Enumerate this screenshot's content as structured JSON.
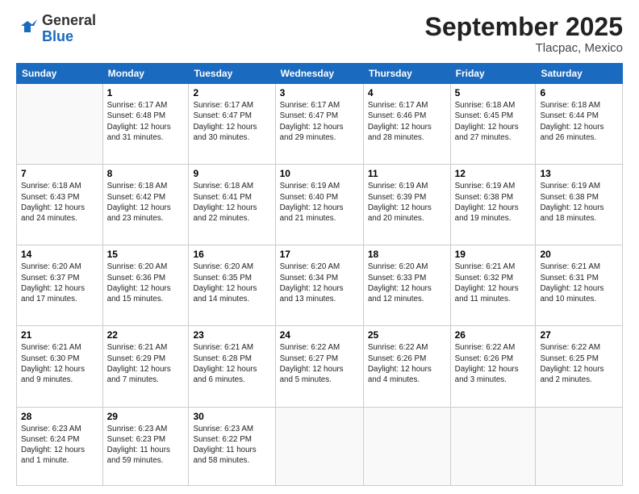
{
  "logo": {
    "general": "General",
    "blue": "Blue"
  },
  "header": {
    "month": "September 2025",
    "location": "Tlacpac, Mexico"
  },
  "weekdays": [
    "Sunday",
    "Monday",
    "Tuesday",
    "Wednesday",
    "Thursday",
    "Friday",
    "Saturday"
  ],
  "weeks": [
    [
      {
        "day": "",
        "info": ""
      },
      {
        "day": "1",
        "info": "Sunrise: 6:17 AM\nSunset: 6:48 PM\nDaylight: 12 hours\nand 31 minutes."
      },
      {
        "day": "2",
        "info": "Sunrise: 6:17 AM\nSunset: 6:47 PM\nDaylight: 12 hours\nand 30 minutes."
      },
      {
        "day": "3",
        "info": "Sunrise: 6:17 AM\nSunset: 6:47 PM\nDaylight: 12 hours\nand 29 minutes."
      },
      {
        "day": "4",
        "info": "Sunrise: 6:17 AM\nSunset: 6:46 PM\nDaylight: 12 hours\nand 28 minutes."
      },
      {
        "day": "5",
        "info": "Sunrise: 6:18 AM\nSunset: 6:45 PM\nDaylight: 12 hours\nand 27 minutes."
      },
      {
        "day": "6",
        "info": "Sunrise: 6:18 AM\nSunset: 6:44 PM\nDaylight: 12 hours\nand 26 minutes."
      }
    ],
    [
      {
        "day": "7",
        "info": "Sunrise: 6:18 AM\nSunset: 6:43 PM\nDaylight: 12 hours\nand 24 minutes."
      },
      {
        "day": "8",
        "info": "Sunrise: 6:18 AM\nSunset: 6:42 PM\nDaylight: 12 hours\nand 23 minutes."
      },
      {
        "day": "9",
        "info": "Sunrise: 6:18 AM\nSunset: 6:41 PM\nDaylight: 12 hours\nand 22 minutes."
      },
      {
        "day": "10",
        "info": "Sunrise: 6:19 AM\nSunset: 6:40 PM\nDaylight: 12 hours\nand 21 minutes."
      },
      {
        "day": "11",
        "info": "Sunrise: 6:19 AM\nSunset: 6:39 PM\nDaylight: 12 hours\nand 20 minutes."
      },
      {
        "day": "12",
        "info": "Sunrise: 6:19 AM\nSunset: 6:38 PM\nDaylight: 12 hours\nand 19 minutes."
      },
      {
        "day": "13",
        "info": "Sunrise: 6:19 AM\nSunset: 6:38 PM\nDaylight: 12 hours\nand 18 minutes."
      }
    ],
    [
      {
        "day": "14",
        "info": "Sunrise: 6:20 AM\nSunset: 6:37 PM\nDaylight: 12 hours\nand 17 minutes."
      },
      {
        "day": "15",
        "info": "Sunrise: 6:20 AM\nSunset: 6:36 PM\nDaylight: 12 hours\nand 15 minutes."
      },
      {
        "day": "16",
        "info": "Sunrise: 6:20 AM\nSunset: 6:35 PM\nDaylight: 12 hours\nand 14 minutes."
      },
      {
        "day": "17",
        "info": "Sunrise: 6:20 AM\nSunset: 6:34 PM\nDaylight: 12 hours\nand 13 minutes."
      },
      {
        "day": "18",
        "info": "Sunrise: 6:20 AM\nSunset: 6:33 PM\nDaylight: 12 hours\nand 12 minutes."
      },
      {
        "day": "19",
        "info": "Sunrise: 6:21 AM\nSunset: 6:32 PM\nDaylight: 12 hours\nand 11 minutes."
      },
      {
        "day": "20",
        "info": "Sunrise: 6:21 AM\nSunset: 6:31 PM\nDaylight: 12 hours\nand 10 minutes."
      }
    ],
    [
      {
        "day": "21",
        "info": "Sunrise: 6:21 AM\nSunset: 6:30 PM\nDaylight: 12 hours\nand 9 minutes."
      },
      {
        "day": "22",
        "info": "Sunrise: 6:21 AM\nSunset: 6:29 PM\nDaylight: 12 hours\nand 7 minutes."
      },
      {
        "day": "23",
        "info": "Sunrise: 6:21 AM\nSunset: 6:28 PM\nDaylight: 12 hours\nand 6 minutes."
      },
      {
        "day": "24",
        "info": "Sunrise: 6:22 AM\nSunset: 6:27 PM\nDaylight: 12 hours\nand 5 minutes."
      },
      {
        "day": "25",
        "info": "Sunrise: 6:22 AM\nSunset: 6:26 PM\nDaylight: 12 hours\nand 4 minutes."
      },
      {
        "day": "26",
        "info": "Sunrise: 6:22 AM\nSunset: 6:26 PM\nDaylight: 12 hours\nand 3 minutes."
      },
      {
        "day": "27",
        "info": "Sunrise: 6:22 AM\nSunset: 6:25 PM\nDaylight: 12 hours\nand 2 minutes."
      }
    ],
    [
      {
        "day": "28",
        "info": "Sunrise: 6:23 AM\nSunset: 6:24 PM\nDaylight: 12 hours\nand 1 minute."
      },
      {
        "day": "29",
        "info": "Sunrise: 6:23 AM\nSunset: 6:23 PM\nDaylight: 11 hours\nand 59 minutes."
      },
      {
        "day": "30",
        "info": "Sunrise: 6:23 AM\nSunset: 6:22 PM\nDaylight: 11 hours\nand 58 minutes."
      },
      {
        "day": "",
        "info": ""
      },
      {
        "day": "",
        "info": ""
      },
      {
        "day": "",
        "info": ""
      },
      {
        "day": "",
        "info": ""
      }
    ]
  ]
}
